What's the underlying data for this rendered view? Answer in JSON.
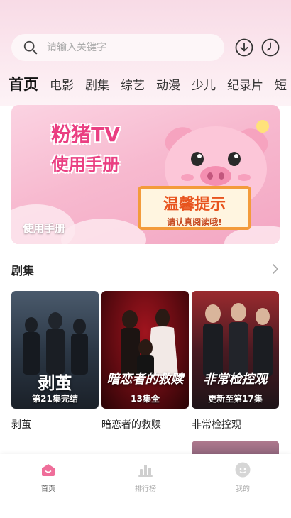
{
  "search": {
    "placeholder": "请输入关键字"
  },
  "header": {
    "download_icon": "download-icon",
    "history_icon": "clock-icon"
  },
  "tabs": [
    {
      "label": "首页",
      "active": true
    },
    {
      "label": "电影"
    },
    {
      "label": "剧集"
    },
    {
      "label": "综艺"
    },
    {
      "label": "动漫"
    },
    {
      "label": "少儿"
    },
    {
      "label": "纪录片"
    },
    {
      "label": "短"
    }
  ],
  "banner": {
    "title_line1": "粉猪TV",
    "title_line2": "使用手册",
    "sign_title": "温馨提示",
    "sign_subtitle": "请认真阅读哦!",
    "label": "使用手册"
  },
  "section": {
    "title": "剧集",
    "more_icon": "chevron-right-icon"
  },
  "cards": [
    {
      "poster_name": "剥茧",
      "badge": "第21集完结",
      "title": "剥茧"
    },
    {
      "poster_name": "暗恋者的救赎",
      "badge": "13集全",
      "title": "暗恋者的救赎"
    },
    {
      "poster_name": "非常检控观",
      "badge": "更新至第17集",
      "title": "非常检控观"
    }
  ],
  "bottom_nav": [
    {
      "label": "首页",
      "icon": "home-icon",
      "active": true
    },
    {
      "label": "排行榜",
      "icon": "ranking-icon"
    },
    {
      "label": "我的",
      "icon": "profile-icon"
    }
  ],
  "colors": {
    "accent": "#ef6e9a",
    "banner_pink": "#f7b9cf",
    "sign_orange": "#f39b3b"
  }
}
